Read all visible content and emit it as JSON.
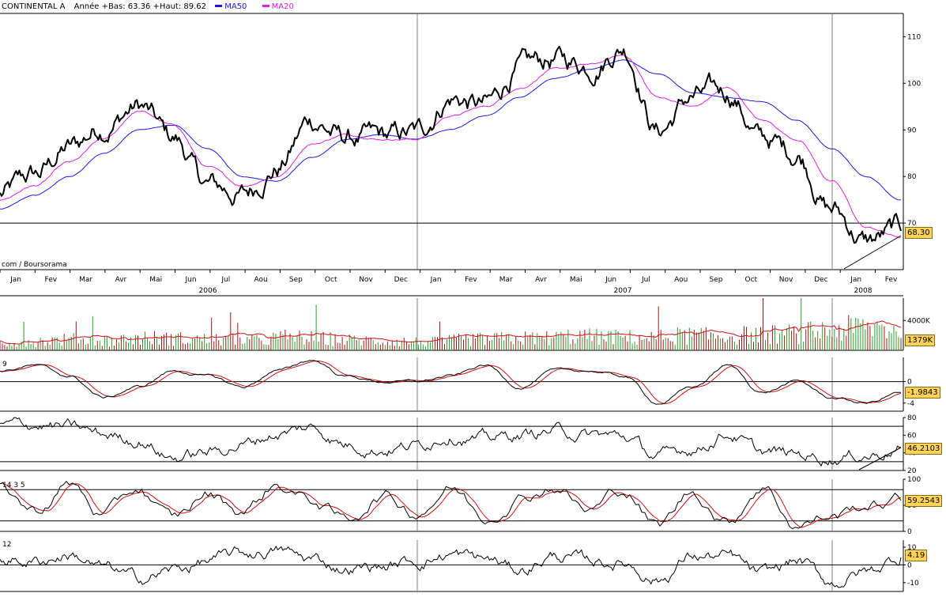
{
  "header": {
    "title": "CONTINENTAL A",
    "range": "Année +Bas: 63.36 +Haut: 89.62",
    "ma50_label": "MA50",
    "ma20_label": "MA20"
  },
  "credit": "com / Boursorama",
  "colors": {
    "price": "#000000",
    "ma50": "#1a1ae0",
    "ma20": "#e020e0",
    "signal": "#d01010",
    "vol_up": "#2a9a2a",
    "vol_down": "#a01818",
    "badge": "#ffd35a",
    "grid": "#808080"
  },
  "chart_data": [
    {
      "type": "line",
      "panel": "price",
      "categories": [
        "Jan",
        "Fev",
        "Mar",
        "Avr",
        "Mai",
        "Jun",
        "Jul",
        "Aou",
        "Sep",
        "Oct",
        "Nov",
        "Dec",
        "Jan",
        "Fev",
        "Mar",
        "Avr",
        "Mai",
        "Jun",
        "Jul",
        "Aou",
        "Sep",
        "Oct",
        "Nov",
        "Dec",
        "Jan",
        "Fev"
      ],
      "years": [
        "2006",
        "2007",
        "2008"
      ],
      "y_ticks": [
        70,
        80,
        90,
        100,
        110
      ],
      "ylim": [
        60,
        115
      ],
      "horizontal_lines": [
        70
      ],
      "series": [
        {
          "name": "CONTINENTAL A",
          "values": [
            76,
            80,
            86,
            91,
            95,
            88,
            78,
            76,
            82,
            92,
            88,
            88,
            89,
            97,
            95,
            103,
            105,
            104,
            108,
            90,
            97,
            98,
            88,
            85,
            73,
            66,
            68.3
          ]
        },
        {
          "name": "MA20",
          "values": [
            75,
            78,
            83,
            88,
            94,
            91,
            82,
            78,
            80,
            87,
            89,
            88,
            88,
            93,
            95,
            99,
            103,
            104,
            106,
            97,
            95,
            99,
            92,
            88,
            79,
            69,
            67
          ]
        },
        {
          "name": "MA50",
          "values": [
            73,
            76,
            80,
            85,
            90,
            91,
            86,
            80,
            79,
            84,
            88,
            89,
            88,
            90,
            93,
            97,
            101,
            103,
            105,
            102,
            98,
            97,
            96,
            92,
            86,
            80,
            75
          ]
        }
      ],
      "last_value_label": "68.30"
    },
    {
      "type": "bar",
      "panel": "volume",
      "y_ticks_labels": [
        "4000K"
      ],
      "ylim": [
        0,
        7000
      ],
      "profile": [
        900,
        1100,
        1300,
        1200,
        1500,
        1400,
        1300,
        1200,
        1600,
        1400,
        1200,
        1100,
        1000,
        1300,
        1400,
        1500,
        1700,
        1600,
        1500,
        1800,
        1700,
        1900,
        2000,
        2400,
        2800,
        2600
      ],
      "last_value_label": "1379K"
    },
    {
      "type": "line",
      "panel": "oscillator-9",
      "label": "9",
      "y_ticks": [
        0,
        -4
      ],
      "ylim": [
        -5.5,
        4.5
      ],
      "values": [
        2,
        3,
        1,
        -3,
        -1,
        2,
        1,
        -1,
        2,
        4,
        1,
        0,
        0,
        1,
        3,
        -1,
        2,
        2,
        1,
        -4,
        -1,
        3,
        -2,
        0,
        -3,
        -4,
        -2
      ],
      "last_value_label": "-1.9843"
    },
    {
      "type": "line",
      "panel": "rsi",
      "y_ticks": [
        80,
        60,
        40,
        20
      ],
      "ylim": [
        20,
        80
      ],
      "horizontal_lines": [
        70,
        30
      ],
      "values": [
        70,
        72,
        68,
        60,
        55,
        35,
        40,
        50,
        62,
        68,
        50,
        45,
        48,
        62,
        55,
        60,
        65,
        60,
        58,
        35,
        45,
        62,
        40,
        38,
        35,
        38,
        46.2
      ],
      "last_value_label": "46.2103"
    },
    {
      "type": "line",
      "panel": "stochastic",
      "label": "14 3 5",
      "y_ticks": [
        100,
        50,
        0
      ],
      "ylim": [
        0,
        100
      ],
      "horizontal_lines": [
        80,
        20
      ],
      "values": [
        85,
        40,
        90,
        30,
        80,
        20,
        70,
        40,
        90,
        60,
        20,
        70,
        40,
        85,
        30,
        70,
        90,
        40,
        80,
        10,
        75,
        20,
        90,
        15,
        30,
        50,
        59.3
      ],
      "last_value_label": "59.2543"
    },
    {
      "type": "line",
      "panel": "momentum-12",
      "label": "12",
      "y_ticks": [
        10,
        0,
        -10
      ],
      "ylim": [
        -15,
        14
      ],
      "values": [
        4,
        2,
        6,
        -2,
        -8,
        -3,
        2,
        6,
        8,
        3,
        -2,
        -1,
        2,
        6,
        3,
        -3,
        5,
        2,
        1,
        -8,
        5,
        4,
        -6,
        2,
        -10,
        -4,
        4.2
      ],
      "last_value_label": "4.19"
    }
  ]
}
